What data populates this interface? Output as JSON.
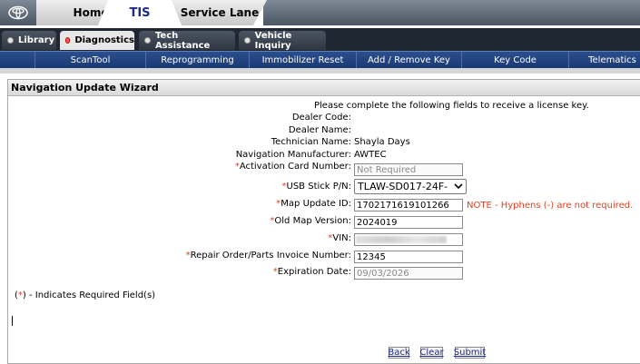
{
  "top_tabs": [
    "Home",
    "TIS",
    "Service Lane"
  ],
  "sub_tabs": [
    {
      "label": "Library",
      "active": false
    },
    {
      "label": "Diagnostics",
      "active": true
    },
    {
      "label": "Tech Assistance",
      "active": false
    },
    {
      "label": "Vehicle Inquiry",
      "active": false
    }
  ],
  "nav_menu": [
    "ScanTool",
    "Reprogramming",
    "Immobilizer Reset",
    "Add / Remove Key",
    "Key Code",
    "Telematics"
  ],
  "panel": {
    "title": "Navigation Update Wizard",
    "intro": "Please complete the following fields to receive a license key."
  },
  "form": {
    "dealer_code_label": "Dealer Code:",
    "dealer_name_label": "Dealer Name:",
    "technician_name_label": "Technician Name:",
    "technician_name_value": "Shayla  Days",
    "nav_manufacturer_label": "Navigation Manufacturer:",
    "nav_manufacturer_value": "AWTEC",
    "required_mark": "*",
    "activation_card_label": "Activation Card Number:",
    "activation_card_value": "Not Required",
    "usb_stick_label": "USB Stick P/N:",
    "usb_stick_value": "TLAW-SD017-24F-",
    "map_update_id_label": "Map Update ID:",
    "map_update_id_value": "1702171619101266",
    "map_update_note": "NOTE - Hyphens (-) are not required.",
    "old_map_version_label": "Old Map Version:",
    "old_map_version_value": "2024019",
    "vin_label": "VIN:",
    "repair_order_label": "Repair Order/Parts Invoice Number:",
    "repair_order_value": "12345",
    "expiration_date_label": "Expiration Date:",
    "expiration_date_value": "09/03/2026"
  },
  "required_note": {
    "open": "(",
    "mark": "*",
    "rest": ") - Indicates Required Field(s)"
  },
  "buttons": {
    "back": "Back",
    "clear": "Clear",
    "submit": "Submit"
  },
  "colors": {
    "required": "#e04020",
    "nav_bar": "#1b3a74",
    "tab_dark": "#2f3641"
  }
}
